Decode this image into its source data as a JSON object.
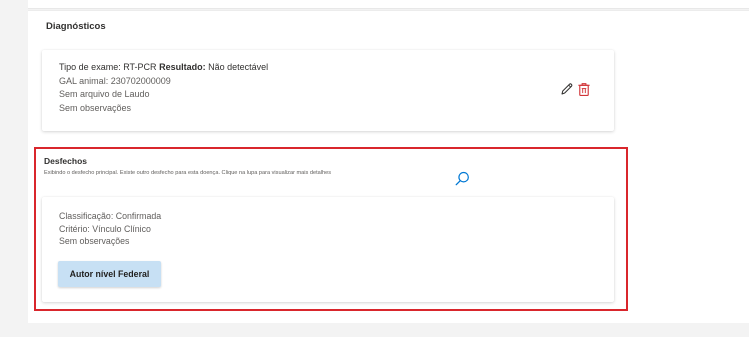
{
  "diagnostics": {
    "title": "Diagnósticos",
    "exam_type_label": "Tipo de exame:",
    "exam_type_value": "RT-PCR",
    "result_label": "Resultado:",
    "result_value": "Não detectável",
    "gal_animal": "GAL animal: 230702000009",
    "report_file": "Sem arquivo de Laudo",
    "observations": "Sem observações",
    "actions": [
      "edit-icon",
      "delete-icon"
    ]
  },
  "outcomes": {
    "title": "Desfechos",
    "note": "Exibindo o desfecho principal. Existe outro desfecho para esta doença.   Clique na lupa para visualizar mais detalhes",
    "search_icon": "search-icon",
    "highlight_color": "#d9262c",
    "classification": "Classificação: Confirmada",
    "criterion": "Critério: Vínculo Clínico",
    "observations": "Sem observações",
    "author_button": "Autor nível Federal",
    "author_button_color": "#c7e0f4"
  }
}
